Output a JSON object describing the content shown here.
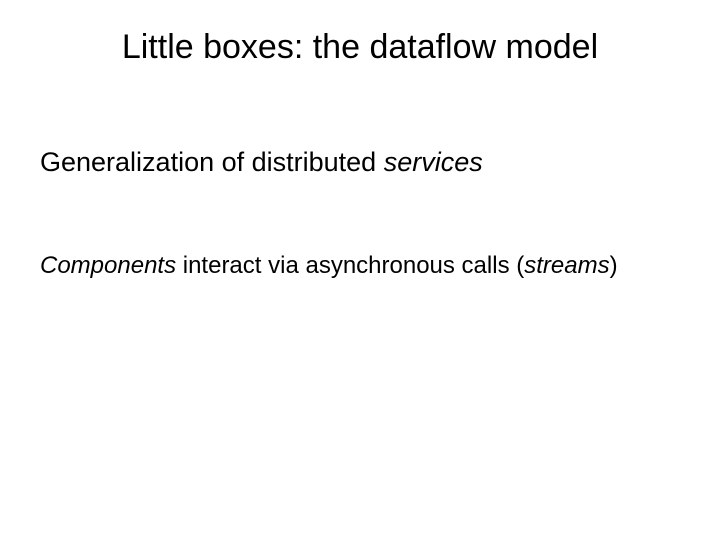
{
  "slide": {
    "title": "Little boxes: the dataflow model",
    "line1_prefix": "Generalization of distributed ",
    "line1_italic": "services",
    "line2_italic1": "Components",
    "line2_mid": " interact via asynchronous calls (",
    "line2_italic2": "streams",
    "line2_suffix": ")"
  }
}
